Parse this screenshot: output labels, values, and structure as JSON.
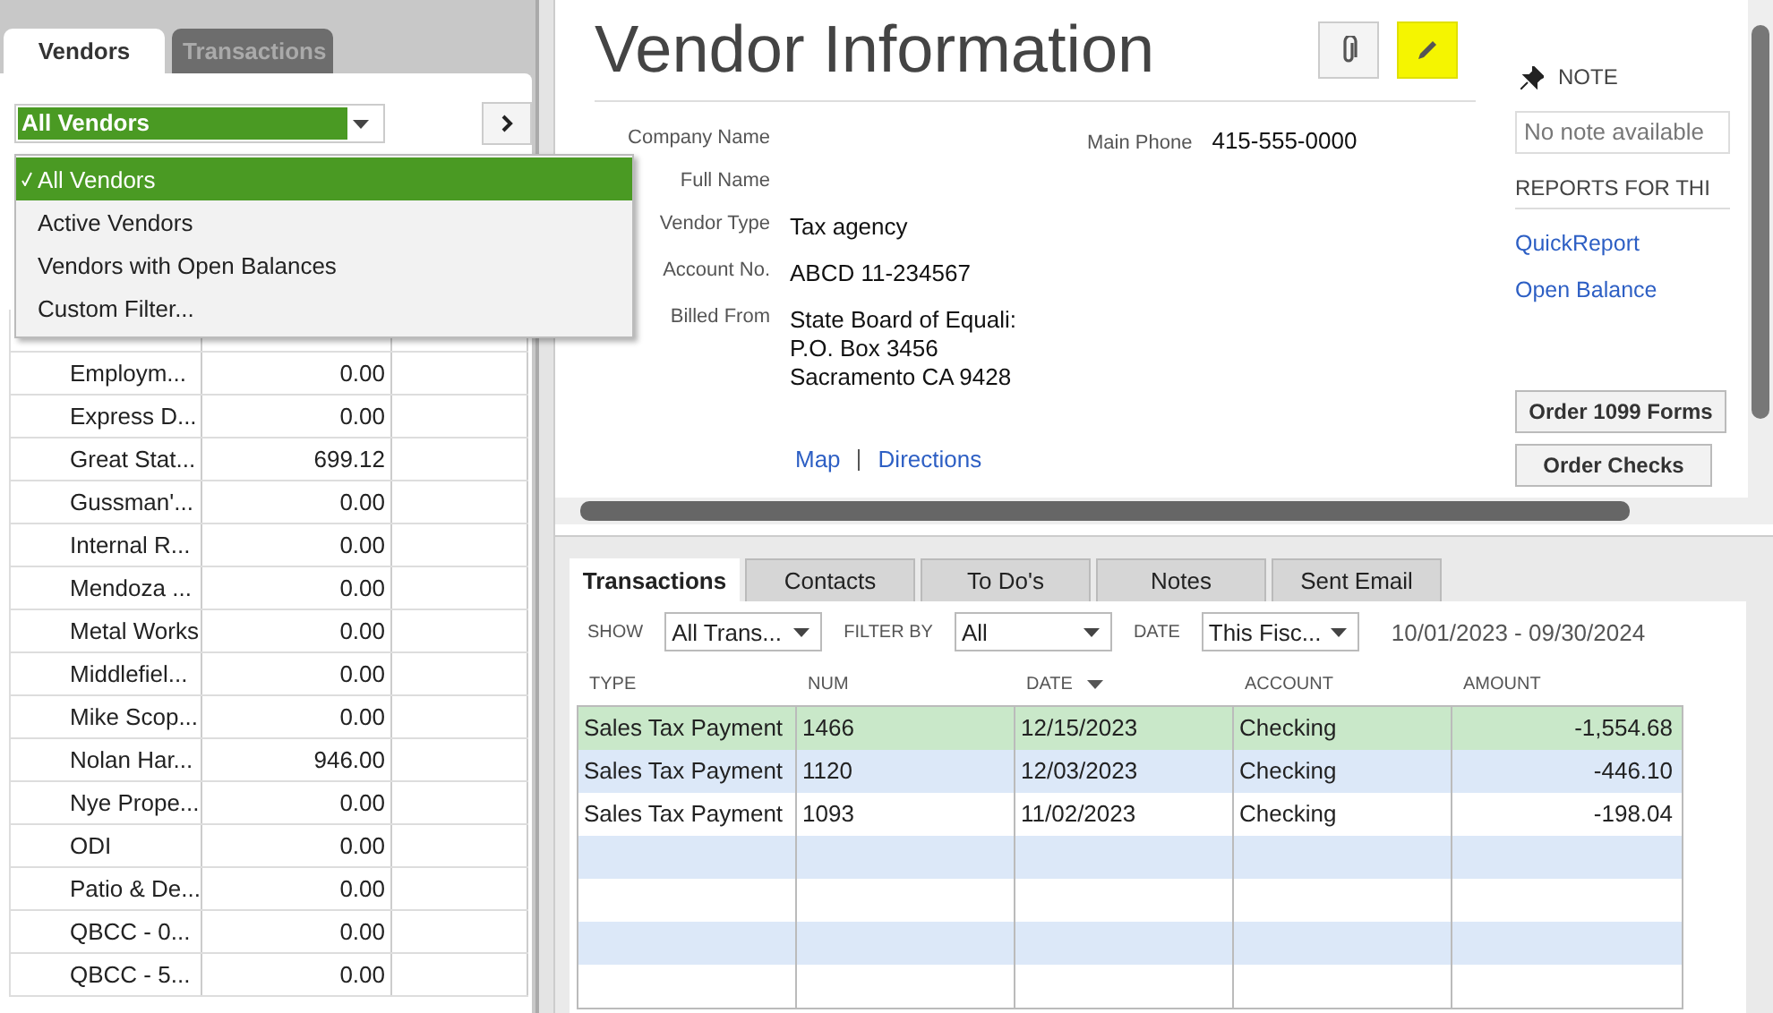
{
  "left_panel": {
    "tabs": [
      {
        "label": "Vendors",
        "selected": true
      },
      {
        "label": "Transactions",
        "selected": false
      }
    ],
    "filter": {
      "value": "All Vendors"
    },
    "filter_menu": [
      {
        "label": "All Vendors",
        "selected": true
      },
      {
        "label": "Active Vendors",
        "selected": false
      },
      {
        "label": "Vendors with Open Balances",
        "selected": false
      },
      {
        "label": "Custom Filter...",
        "selected": false
      }
    ],
    "vendors": [
      {
        "name": "Employm...",
        "balance": "0.00"
      },
      {
        "name": "Express D...",
        "balance": "0.00"
      },
      {
        "name": "Great Stat...",
        "balance": "699.12"
      },
      {
        "name": "Gussman'...",
        "balance": "0.00"
      },
      {
        "name": "Internal R...",
        "balance": "0.00"
      },
      {
        "name": "Mendoza ...",
        "balance": "0.00"
      },
      {
        "name": "Metal Works",
        "balance": "0.00"
      },
      {
        "name": "Middlefiel...",
        "balance": "0.00"
      },
      {
        "name": "Mike Scop...",
        "balance": "0.00"
      },
      {
        "name": "Nolan Har...",
        "balance": "946.00"
      },
      {
        "name": "Nye Prope...",
        "balance": "0.00"
      },
      {
        "name": "ODI",
        "balance": "0.00"
      },
      {
        "name": "Patio & De...",
        "balance": "0.00"
      },
      {
        "name": "QBCC - 0...",
        "balance": "0.00"
      },
      {
        "name": "QBCC - 5...",
        "balance": "0.00"
      }
    ]
  },
  "vendor_info": {
    "title": "Vendor Information",
    "edit_highlighted": true,
    "fields": [
      {
        "label": "Company Name"
      },
      {
        "label": "Full Name"
      },
      {
        "label": "Vendor Type",
        "lines": [
          "Tax agency"
        ]
      },
      {
        "label": "Account No.",
        "lines": [
          "ABCD 11-234567"
        ]
      },
      {
        "label": "Billed From",
        "lines": [
          "State Board of Equali:",
          "P.O. Box 3456",
          "Sacramento CA 9428"
        ]
      }
    ],
    "main_phone": {
      "label": "Main Phone",
      "value": "415-555-0000"
    },
    "links": [
      "Map",
      "Directions"
    ],
    "note": {
      "heading": "NOTE",
      "text": "No note available"
    },
    "reports": {
      "heading": "REPORTS FOR THI",
      "links": [
        "QuickReport",
        "Open Balance"
      ]
    },
    "buttons": [
      "Order 1099 Forms",
      "Order Checks"
    ]
  },
  "transactions": {
    "tabs": [
      {
        "label": "Transactions",
        "selected": true
      },
      {
        "label": "Contacts",
        "selected": false
      },
      {
        "label": "To Do's",
        "selected": false
      },
      {
        "label": "Notes",
        "selected": false
      },
      {
        "label": "Sent Email",
        "selected": false
      }
    ],
    "filters": [
      {
        "label": "SHOW",
        "value": "All Trans..."
      },
      {
        "label": "FILTER BY",
        "value": "All"
      },
      {
        "label": "DATE",
        "value": "This Fisc..."
      }
    ],
    "date_range": "10/01/2023 - 09/30/2024",
    "columns": [
      {
        "label": "TYPE",
        "sorted": false
      },
      {
        "label": "NUM",
        "sorted": false
      },
      {
        "label": "DATE",
        "sorted": true
      },
      {
        "label": "ACCOUNT",
        "sorted": false
      },
      {
        "label": "AMOUNT",
        "sorted": false
      }
    ],
    "rows": [
      {
        "cells": [
          "Sales Tax Payment",
          "1466",
          "12/15/2023",
          "Checking",
          "-1,554.68"
        ],
        "selected": true
      },
      {
        "cells": [
          "Sales Tax Payment",
          "1120",
          "12/03/2023",
          "Checking",
          "-446.10"
        ],
        "selected": false
      },
      {
        "cells": [
          "Sales Tax Payment",
          "1093",
          "11/02/2023",
          "Checking",
          "-198.04"
        ],
        "selected": false
      }
    ]
  }
}
